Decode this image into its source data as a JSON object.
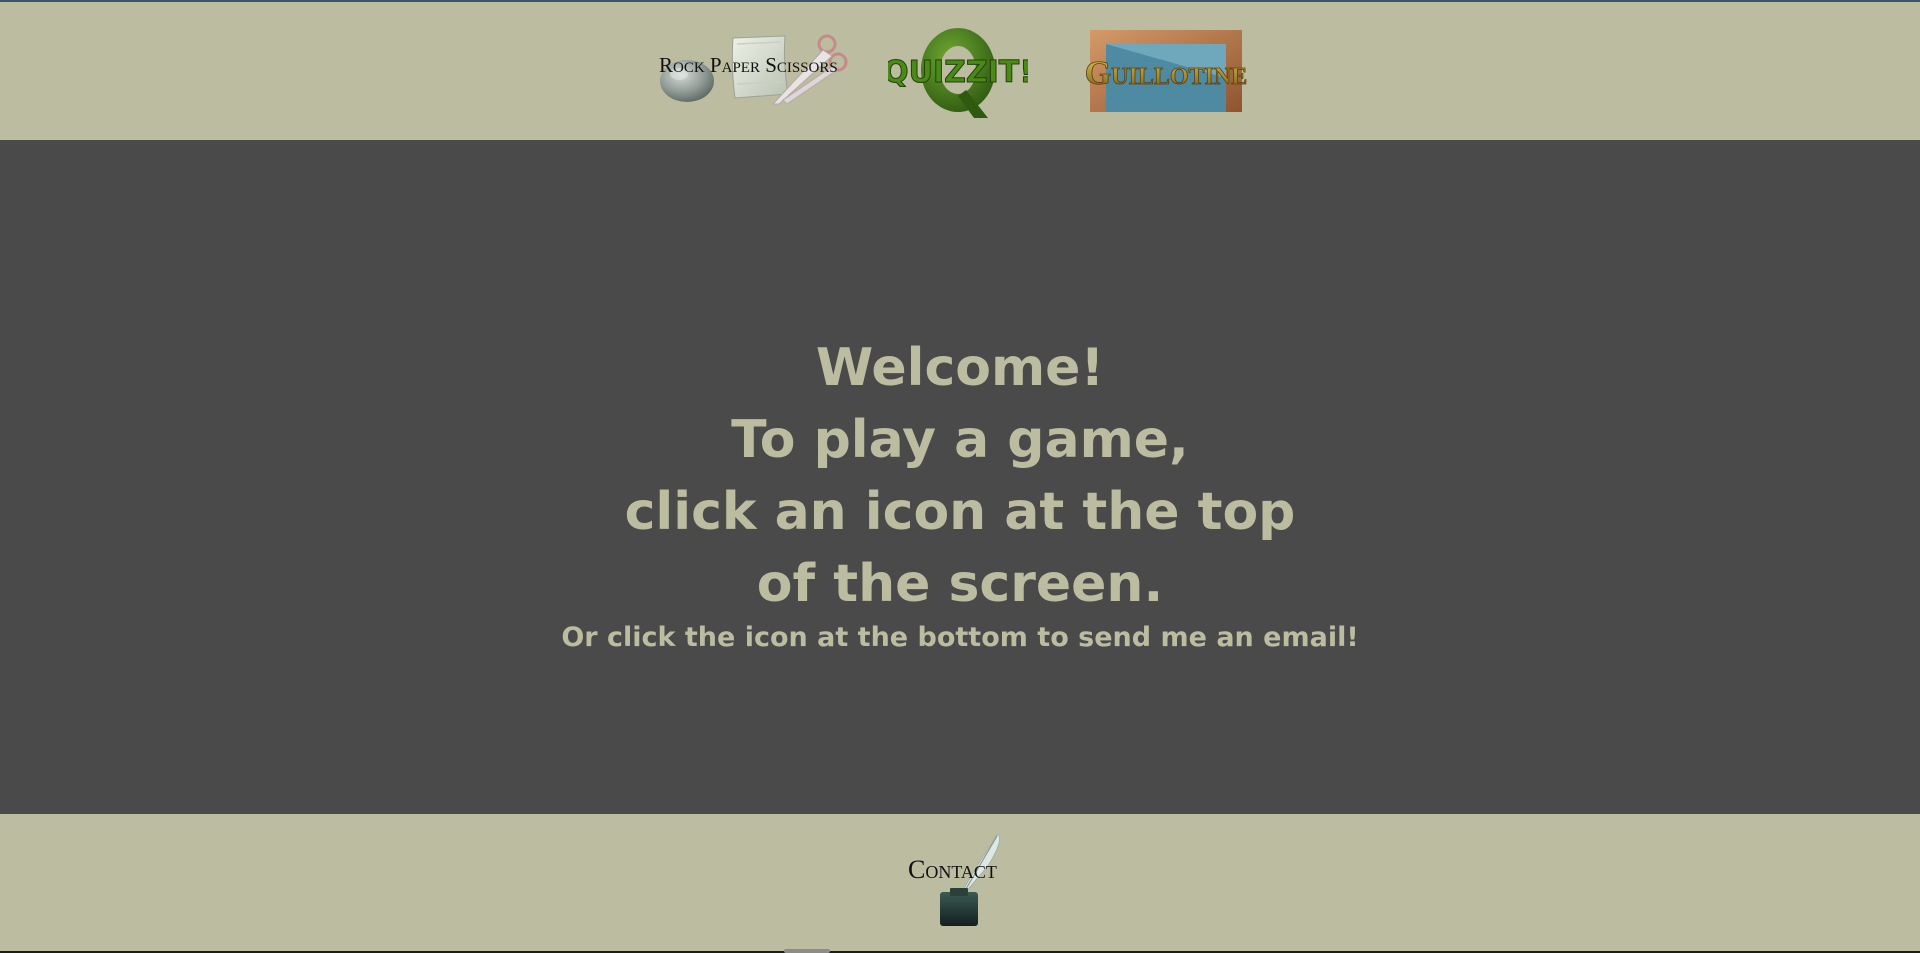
{
  "header": {
    "games": [
      {
        "id": "rps",
        "label": "Rock Paper Scissors",
        "icon": "rock-paper-scissors-icon"
      },
      {
        "id": "quizzit",
        "label": "QUIZZIT!",
        "icon": "quizzit-icon"
      },
      {
        "id": "guillotine",
        "label": "Guillotine",
        "icon": "guillotine-icon"
      }
    ]
  },
  "main": {
    "line1": "Welcome!",
    "line2": "To play a game,",
    "line3": "click an icon at the top",
    "line4": "of the screen.",
    "sub": "Or click the icon at the bottom to send me an email!"
  },
  "footer": {
    "contact_label": "Contact",
    "icon": "inkwell-quill-icon"
  },
  "colors": {
    "bar": "#bcbca1",
    "main": "#4a4a4a",
    "text": "#bcbca1"
  }
}
